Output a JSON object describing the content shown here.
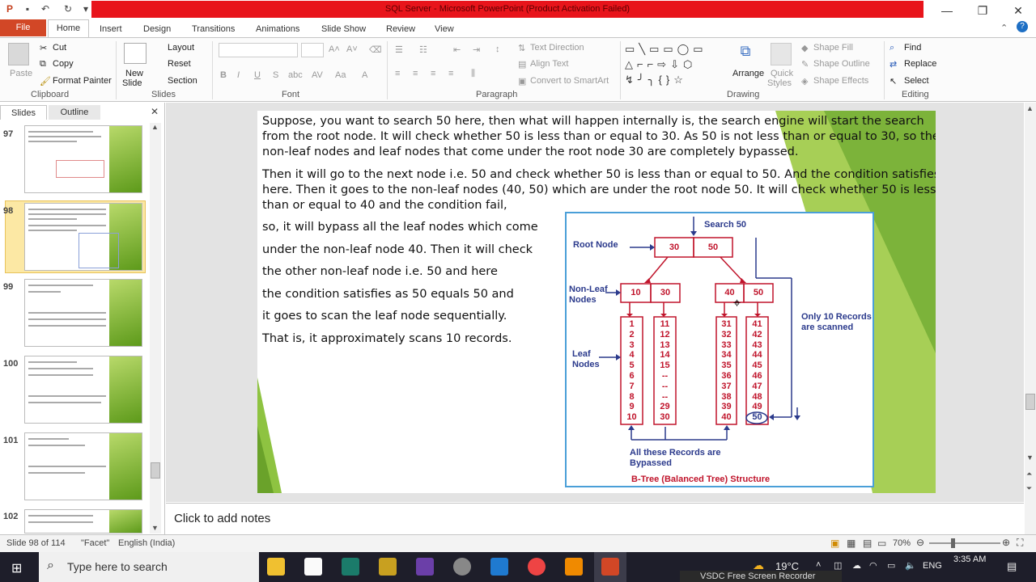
{
  "window": {
    "title": "SQL Server - Microsoft PowerPoint (Product Activation Failed)",
    "minimize": "—",
    "maximize": "❐",
    "close": "✕"
  },
  "tabs": [
    "File",
    "Home",
    "Insert",
    "Design",
    "Transitions",
    "Animations",
    "Slide Show",
    "Review",
    "View"
  ],
  "ribbon": {
    "clipboard": {
      "paste": "Paste",
      "cut": "Cut",
      "copy": "Copy",
      "format_painter": "Format Painter",
      "group": "Clipboard"
    },
    "slides": {
      "new_slide_line1": "New",
      "new_slide_line2": "Slide",
      "layout": "Layout",
      "reset": "Reset",
      "section": "Section",
      "group": "Slides"
    },
    "font": {
      "group": "Font"
    },
    "paragraph": {
      "text_direction": "Text Direction",
      "align_text": "Align Text",
      "convert_smartart": "Convert to SmartArt",
      "group": "Paragraph"
    },
    "drawing": {
      "arrange": "Arrange",
      "quick_styles_line1": "Quick",
      "quick_styles_line2": "Styles",
      "shape_fill": "Shape Fill",
      "shape_outline": "Shape Outline",
      "shape_effects": "Shape Effects",
      "group": "Drawing"
    },
    "editing": {
      "find": "Find",
      "replace": "Replace",
      "select": "Select",
      "group": "Editing"
    }
  },
  "left_panel": {
    "tab_slides": "Slides",
    "tab_outline": "Outline",
    "slide_numbers": [
      "97",
      "98",
      "99",
      "100",
      "101",
      "102"
    ]
  },
  "slide": {
    "para1": [
      "Suppose, you want to search 50 here, then what will happen internally is, the search engine will start the search",
      "from the root node. It will check whether 50 is less than or equal to 30. As 50 is not less than or equal to 30, so the",
      "non-leaf nodes and leaf nodes that come under the root node 30 are completely bypassed."
    ],
    "para2": [
      "Then it will go to the next node i.e. 50 and check whether 50 is less than or equal to 50. And the condition satisfies",
      "here. Then it goes to the non-leaf nodes (40, 50) which are under the root node 50. It will check whether 50 is less",
      "than or equal to 40 and the condition fail,"
    ],
    "para3": [
      "so, it will bypass all the leaf nodes which come",
      "under the non-leaf node 40. Then it will check",
      "the other non-leaf node i.e. 50 and here",
      "the condition satisfies as 50 equals 50 and",
      "it goes to scan the leaf node sequentially.",
      "That is, it approximately scans 10 records."
    ]
  },
  "diagram": {
    "search_label": "Search 50",
    "root_label": "Root Node",
    "root_values": [
      "30",
      "50"
    ],
    "nonleaf_label_1": "Non-Leaf",
    "nonleaf_label_2": "Nodes",
    "nonleaf_left": [
      "10",
      "30"
    ],
    "nonleaf_right": [
      "40",
      "50"
    ],
    "leaf_label_1": "Leaf",
    "leaf_label_2": "Nodes",
    "leaf_col1": "1\n2\n3\n4\n5\n6\n7\n8\n9\n10",
    "leaf_col2": "11\n12\n13\n14\n15\n--\n--\n--\n29\n30",
    "leaf_col3": "31\n32\n33\n34\n35\n36\n37\n38\n39\n40",
    "leaf_col4": "41\n42\n43\n44\n45\n46\n47\n48\n49",
    "leaf_col4_last": "50",
    "only10_1": "Only 10 Records",
    "only10_2": "are scanned",
    "bypassed_1": "All these Records are",
    "bypassed_2": "Bypassed",
    "caption": "B-Tree (Balanced Tree) Structure"
  },
  "notes": {
    "placeholder": "Click to add notes"
  },
  "status": {
    "slide_info": "Slide 98 of 114",
    "theme": "\"Facet\"",
    "language": "English (India)",
    "zoom": "70%"
  },
  "taskbar": {
    "search_placeholder": "Type here to search",
    "weather": "19°C",
    "lang": "ENG",
    "time": "3:35 AM",
    "recorder": "VSDC Free Screen Recorder"
  }
}
